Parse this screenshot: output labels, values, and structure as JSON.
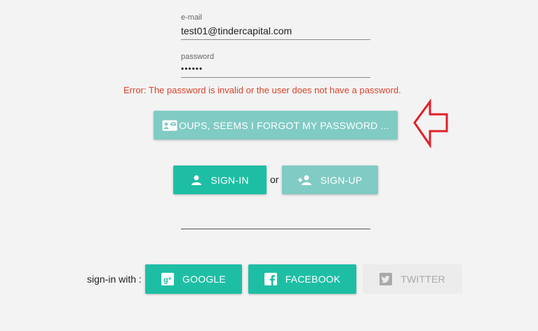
{
  "login_form": {
    "email": {
      "label": "e-mail",
      "value": "test01@tindercapital.com"
    },
    "password": {
      "label": "password",
      "value": "••••••"
    },
    "error_message": "Error: The password is invalid or the user does not have a password.",
    "forgot_button": {
      "label": "OUPS, SEEMS I FORGOT MY PASSWORD ...",
      "icon": "contact-mail-icon"
    },
    "signin_button": {
      "label": "SIGN-IN",
      "icon": "person-icon"
    },
    "or_text": "or",
    "signup_button": {
      "label": "SIGN-UP",
      "icon": "person-add-icon"
    }
  },
  "social": {
    "prefix": "sign-in with :",
    "google": {
      "label": "GOOGLE",
      "icon": "google-plus-icon"
    },
    "facebook": {
      "label": "FACEBOOK",
      "icon": "facebook-icon"
    },
    "twitter": {
      "label": "TWITTER",
      "icon": "twitter-icon",
      "disabled": true
    }
  },
  "annotation": {
    "arrow_color": "#e0202a",
    "direction": "left"
  },
  "colors": {
    "accent": "#1ebea5",
    "accent_light": "#80cbc4",
    "error": "#d8442a"
  }
}
